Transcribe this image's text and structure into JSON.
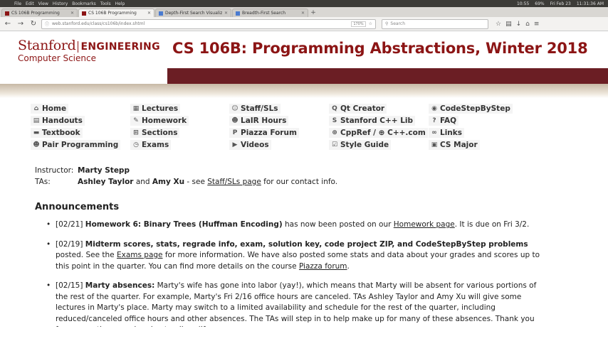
{
  "os": {
    "menus": [
      "File",
      "Edit",
      "View",
      "History",
      "Bookmarks",
      "Tools",
      "Help"
    ],
    "battery": "69%",
    "time1": "10:55",
    "date": "Fri Feb 23",
    "time2": "11:31:36 AM"
  },
  "tabs": [
    {
      "label": "CS 106B Programming",
      "active": false
    },
    {
      "label": "CS 106B Programming",
      "active": true
    },
    {
      "label": "Depth-First Search Visualizer",
      "active": false
    },
    {
      "label": "Breadth-First Search",
      "active": false
    }
  ],
  "browser": {
    "url": "web.stanford.edu/class/cs106b/index.shtml",
    "zoom": "170%",
    "search_placeholder": "Search"
  },
  "header": {
    "logo_stanford": "Stanford",
    "logo_engineering": "ENGINEERING",
    "logo_cs": "Computer Science",
    "title": "CS 106B: Programming Abstractions, Winter 2018"
  },
  "nav": {
    "home": "Home",
    "handouts": "Handouts",
    "textbook": "Textbook",
    "pair": "Pair Programming",
    "lectures": "Lectures",
    "homework": "Homework",
    "sections": "Sections",
    "exams": "Exams",
    "staff": "Staff/SLs",
    "lair": "LaIR Hours",
    "piazza": "Piazza Forum",
    "videos": "Videos",
    "qt": "Qt Creator",
    "stanlib": "Stanford C++ Lib",
    "cppref": "CppRef / ⊕ C++.com",
    "style": "Style Guide",
    "codestep": "CodeStepByStep",
    "faq": "FAQ",
    "links": "Links",
    "major": "CS Major"
  },
  "staff": {
    "instructor_label": "Instructor:",
    "instructor": "Marty Stepp",
    "tas_label": "TAs:",
    "tas": "Ashley Taylor",
    "and": " and ",
    "ta2": "Amy Xu",
    "see": " - see ",
    "staff_link": "Staff/SLs page",
    "contact": " for our contact info."
  },
  "announcements": {
    "title": "Announcements",
    "a1_date": "[02/21] ",
    "a1_bold": "Homework 6: Binary Trees (Huffman Encoding)",
    "a1_text": " has now been posted on our ",
    "a1_link": "Homework page",
    "a1_end": ". It is due on Fri 3/2.",
    "a2_date": "[02/19] ",
    "a2_bold": "Midterm scores, stats, regrade info, exam, solution key, code project ZIP, and CodeStepByStep problems",
    "a2_text": " posted. See the ",
    "a2_link": "Exams page",
    "a2_mid": " for more information. We have also posted some stats and data about your grades and scores up to this point in the quarter. You can find more details on the course ",
    "a2_link2": "Piazza forum",
    "a2_end": ".",
    "a3_date": "[02/15] ",
    "a3_bold": "Marty absences:",
    "a3_text": " Marty's wife has gone into labor (yay!), which means that Marty will be absent for various portions of the rest of the quarter. For example, Marty's Fri 2/16 office hours are canceled. TAs Ashley Taylor and Amy Xu will give some lectures in Marty's place. Marty may switch to a limited availability and schedule for the rest of the quarter, including reduced/canceled office hours and other absences. The TAs will step in to help make up for many of these absences. Thank you for your patience and understanding. (If"
  }
}
